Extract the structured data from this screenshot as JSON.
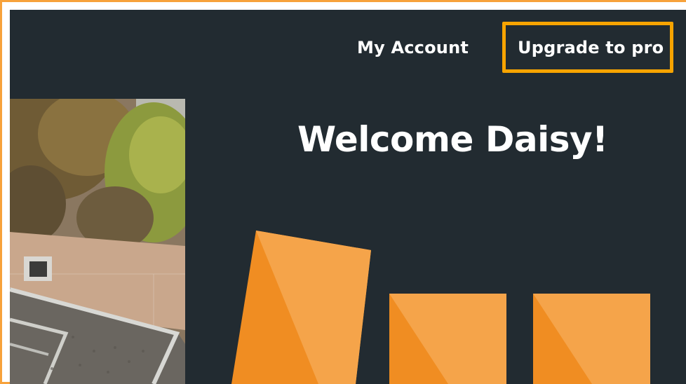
{
  "nav": {
    "my_account": "My Account",
    "upgrade": "Upgrade to pro"
  },
  "welcome": {
    "heading": "Welcome Daisy!"
  },
  "colors": {
    "background": "#222b31",
    "accent": "#f7a400",
    "frame": "#f7a23b",
    "shape_dark": "#f08d22",
    "shape_light": "#f5a44a"
  }
}
